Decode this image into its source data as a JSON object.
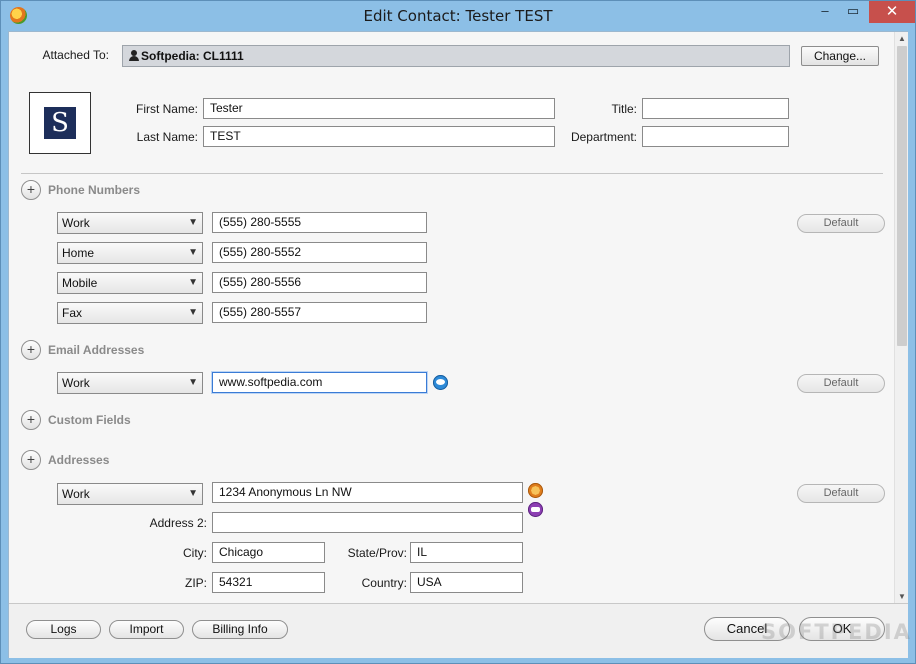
{
  "window": {
    "title": "Edit Contact: Tester TEST",
    "controls": {
      "minimize": "‒",
      "maximize": "▭",
      "close": "✕"
    }
  },
  "attached": {
    "label": "Attached To:",
    "value": "Softpedia: CL1111",
    "change_button": "Change..."
  },
  "avatar": {
    "letter": "S"
  },
  "name": {
    "first_label": "First Name:",
    "first_value": "Tester",
    "last_label": "Last Name:",
    "last_value": "TEST",
    "title_label": "Title:",
    "title_value": "",
    "department_label": "Department:",
    "department_value": ""
  },
  "phones": {
    "section_title": "Phone Numbers",
    "default_button": "Default",
    "items": [
      {
        "type": "Work",
        "value": "(555) 280-5555"
      },
      {
        "type": "Home",
        "value": "(555) 280-5552"
      },
      {
        "type": "Mobile",
        "value": "(555) 280-5556"
      },
      {
        "type": "Fax",
        "value": "(555) 280-5557"
      }
    ]
  },
  "emails": {
    "section_title": "Email Addresses",
    "default_button": "Default",
    "items": [
      {
        "type": "Work",
        "value": "www.softpedia.com"
      }
    ]
  },
  "custom_fields": {
    "section_title": "Custom Fields"
  },
  "addresses": {
    "section_title": "Addresses",
    "default_button": "Default",
    "type": "Work",
    "street": "1234 Anonymous Ln NW",
    "address2_label": "Address 2:",
    "address2": "",
    "city_label": "City:",
    "city": "Chicago",
    "state_label": "State/Prov:",
    "state": "IL",
    "zip_label": "ZIP:",
    "zip": "54321",
    "country_label": "Country:",
    "country": "USA"
  },
  "footer": {
    "logs": "Logs",
    "import": "Import",
    "billing": "Billing Info",
    "cancel": "Cancel",
    "ok": "OK",
    "watermark": "SOFTPEDIA"
  },
  "icons": {
    "section_expand": "+",
    "dropdown": "▼",
    "scroll_up": "▲",
    "scroll_down": "▼"
  }
}
